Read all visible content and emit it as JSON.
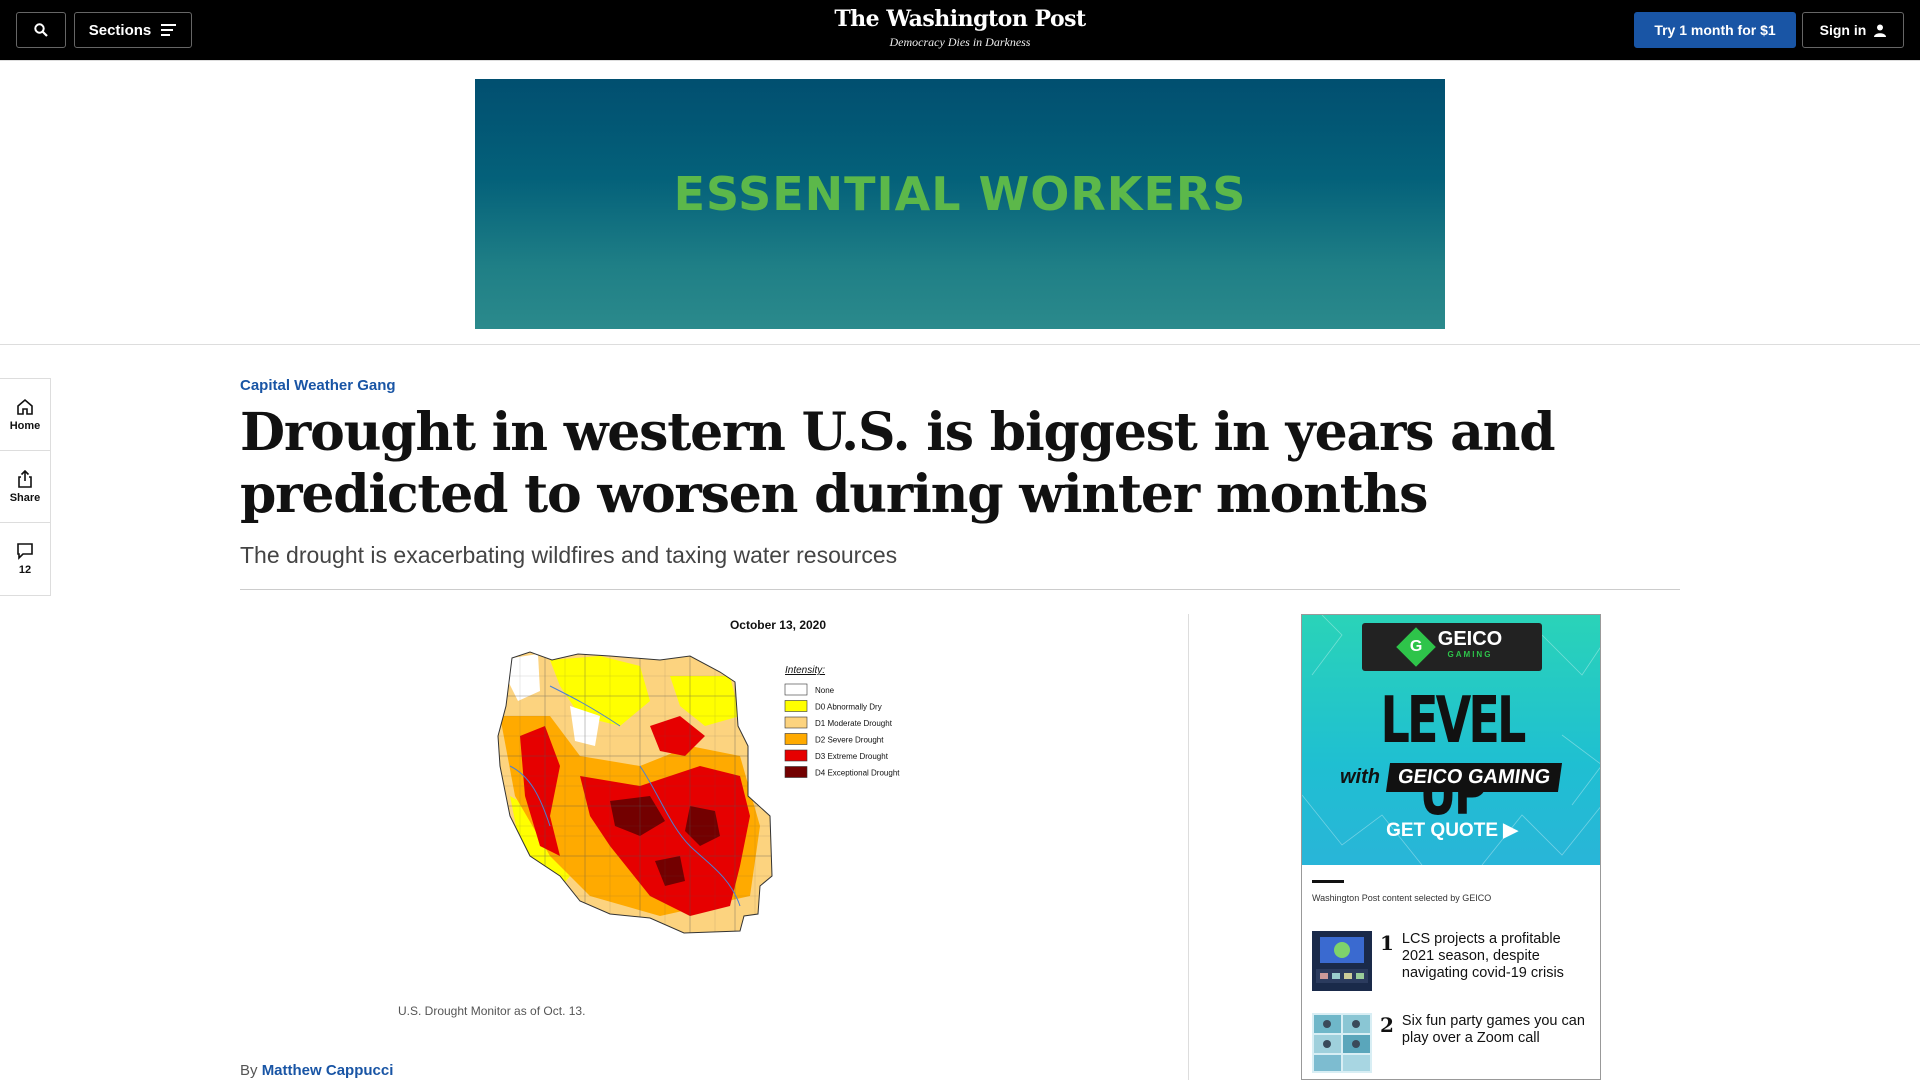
{
  "header": {
    "search_icon": "search-icon",
    "sections_label": "Sections",
    "logo_name": "The Washington Post",
    "logo_tagline": "Democracy Dies in Darkness",
    "try_label": "Try 1 month for $1",
    "signin_label": "Sign in"
  },
  "banner_ad": {
    "text": "ESSENTIAL WORKERS"
  },
  "rail": {
    "home_label": "Home",
    "share_label": "Share",
    "comments_count": "12"
  },
  "article": {
    "kicker": "Capital Weather Gang",
    "headline": "Drought in western U.S. is biggest in years and predicted to worsen during winter months",
    "dek": "The drought is exacerbating wildfires and taxing water resources",
    "map_date": "October 13, 2020",
    "caption": "U.S. Drought Monitor as of Oct. 13.",
    "byline_prefix": "By",
    "author": "Matthew Cappucci"
  },
  "map_legend": {
    "title": "Intensity:",
    "items": [
      {
        "label": "None",
        "color": "#ffffff"
      },
      {
        "label": "D0 Abnormally Dry",
        "color": "#ffff00"
      },
      {
        "label": "D1 Moderate Drought",
        "color": "#fcd37f"
      },
      {
        "label": "D2 Severe Drought",
        "color": "#ffaa00"
      },
      {
        "label": "D3 Extreme Drought",
        "color": "#e60000"
      },
      {
        "label": "D4 Exceptional Drought",
        "color": "#730000"
      }
    ]
  },
  "side_ad": {
    "brand": "GEICO",
    "brand_sub": "GAMING",
    "headline": "LEVEL UP",
    "with": "with",
    "with_brand": "GEICO GAMING",
    "cta": "GET QUOTE ▶",
    "selected_by": "Washington Post content selected by GEICO",
    "stories": [
      {
        "num": "1",
        "title": "LCS projects a profitable 2021 season, despite navigating covid-19 crisis"
      },
      {
        "num": "2",
        "title": "Six fun party games you can play over a Zoom call"
      }
    ]
  }
}
